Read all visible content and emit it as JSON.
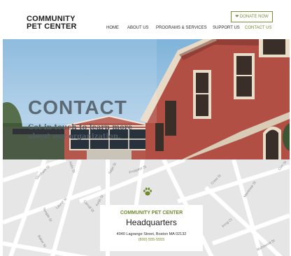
{
  "brand": {
    "line1": "COMMUNITY",
    "line2": "PET CENTER"
  },
  "header": {
    "donate_label": "❤ DONATE NOW"
  },
  "nav": [
    {
      "label": "HOME",
      "active": false
    },
    {
      "label": "ABOUT US",
      "active": false
    },
    {
      "label": "PROGRAMS & SERVICES",
      "active": false
    },
    {
      "label": "SUPPORT US",
      "active": false
    },
    {
      "label": "CONTACT US",
      "active": true
    }
  ],
  "hero": {
    "title": "CONTACT",
    "subtitle": "Get in touch to learn more about our organization."
  },
  "map": {
    "streets": [
      "Gloriham St",
      "Laurel St",
      "Temple St",
      "Baker St",
      "Keith St",
      "Aldis St",
      "Sage St",
      "Prospect St",
      "Carroll St",
      "Crest St",
      "Montrose St",
      "Richmond St",
      "Irvng Ct",
      "Corr St"
    ],
    "marker_icon": "paw-icon"
  },
  "location": {
    "org": "COMMUNITY PET CENTER",
    "title": "Headquarters",
    "address": "4040 Lagrange Street, Boston MA 02132",
    "phone": "(800) 555-5555"
  },
  "colors": {
    "accent": "#6f8a2e",
    "brick": "#b5534a",
    "map_bg": "#e6e6e6"
  }
}
